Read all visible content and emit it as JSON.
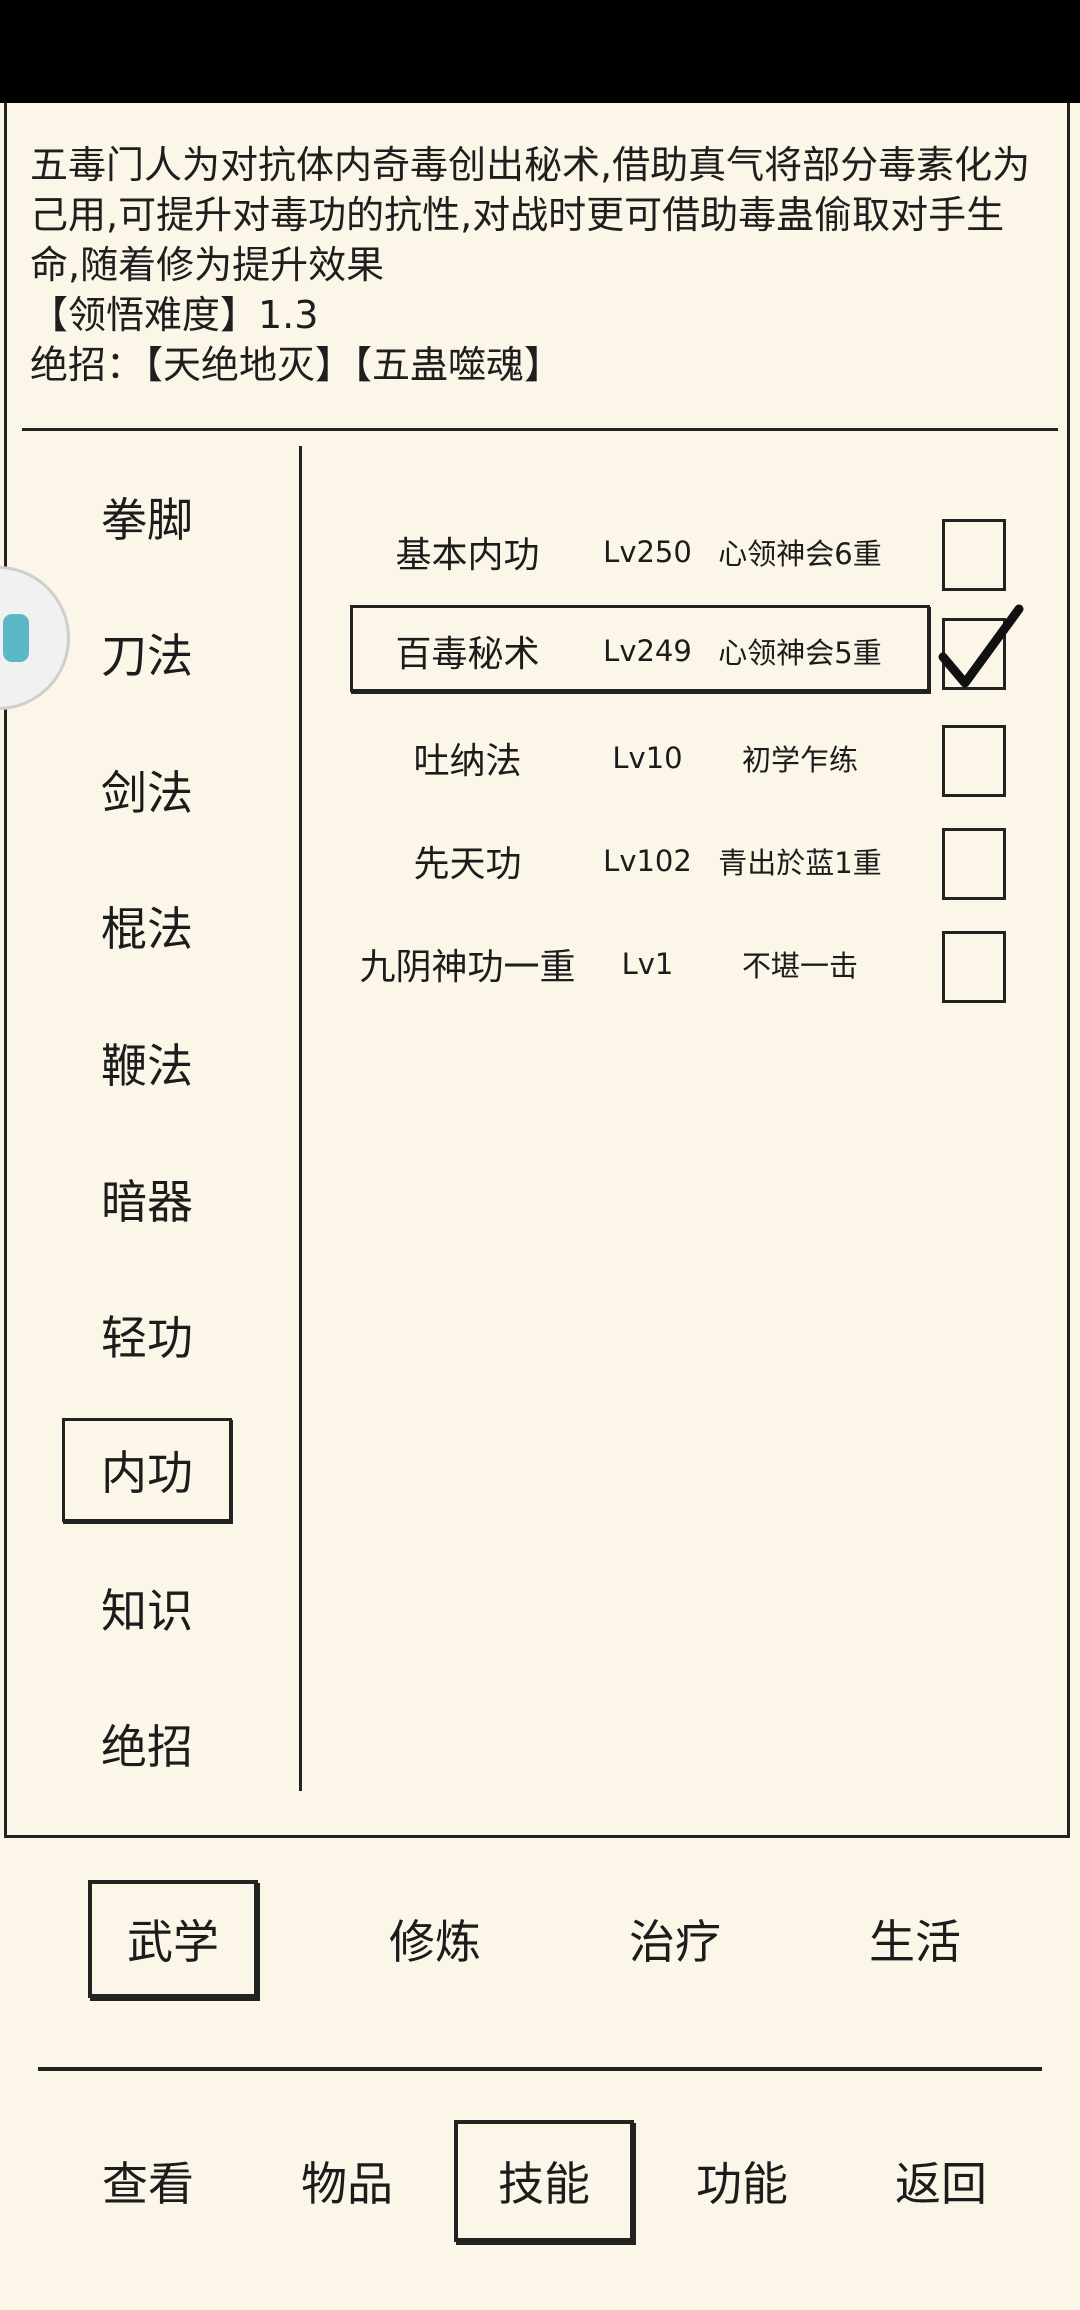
{
  "description": {
    "lines": [
      "五毒门人为对抗体内奇毒创出秘术,借助真气将部分毒素化为",
      "己用,可提升对毒功的抗性,对战时更可借助毒蛊偷取对手生",
      "命,随着修为提升效果"
    ],
    "difficulty": "【领悟难度】1.3",
    "ultimate": "绝招：【天绝地灭】【五蛊噬魂】"
  },
  "categories": [
    {
      "label": "拳脚",
      "selected": false
    },
    {
      "label": "刀法",
      "selected": false
    },
    {
      "label": "剑法",
      "selected": false
    },
    {
      "label": "棍法",
      "selected": false
    },
    {
      "label": "鞭法",
      "selected": false
    },
    {
      "label": "暗器",
      "selected": false
    },
    {
      "label": "轻功",
      "selected": false
    },
    {
      "label": "内功",
      "selected": true
    },
    {
      "label": "知识",
      "selected": false
    },
    {
      "label": "绝招",
      "selected": false
    }
  ],
  "skills": [
    {
      "name": "基本内功",
      "level": "Lv250",
      "status": "心领神会6重",
      "checked": false,
      "selected": false
    },
    {
      "name": "百毒秘术",
      "level": "Lv249",
      "status": "心领神会5重",
      "checked": true,
      "selected": true
    },
    {
      "name": "吐纳法",
      "level": "Lv10",
      "status": "初学乍练",
      "checked": false,
      "selected": false
    },
    {
      "name": "先天功",
      "level": "Lv102",
      "status": "青出於蓝1重",
      "checked": false,
      "selected": false
    },
    {
      "name": "九阴神功一重",
      "level": "Lv1",
      "status": "不堪一击",
      "checked": false,
      "selected": false
    }
  ],
  "subtabs": [
    {
      "label": "武学",
      "selected": true
    },
    {
      "label": "修炼",
      "selected": false
    },
    {
      "label": "治疗",
      "selected": false
    },
    {
      "label": "生活",
      "selected": false
    }
  ],
  "nav": [
    {
      "label": "查看",
      "selected": false
    },
    {
      "label": "物品",
      "selected": false
    },
    {
      "label": "技能",
      "selected": true
    },
    {
      "label": "功能",
      "selected": false
    },
    {
      "label": "返回",
      "selected": false
    }
  ],
  "floating_button": {
    "icon": "floating-ball-icon"
  }
}
